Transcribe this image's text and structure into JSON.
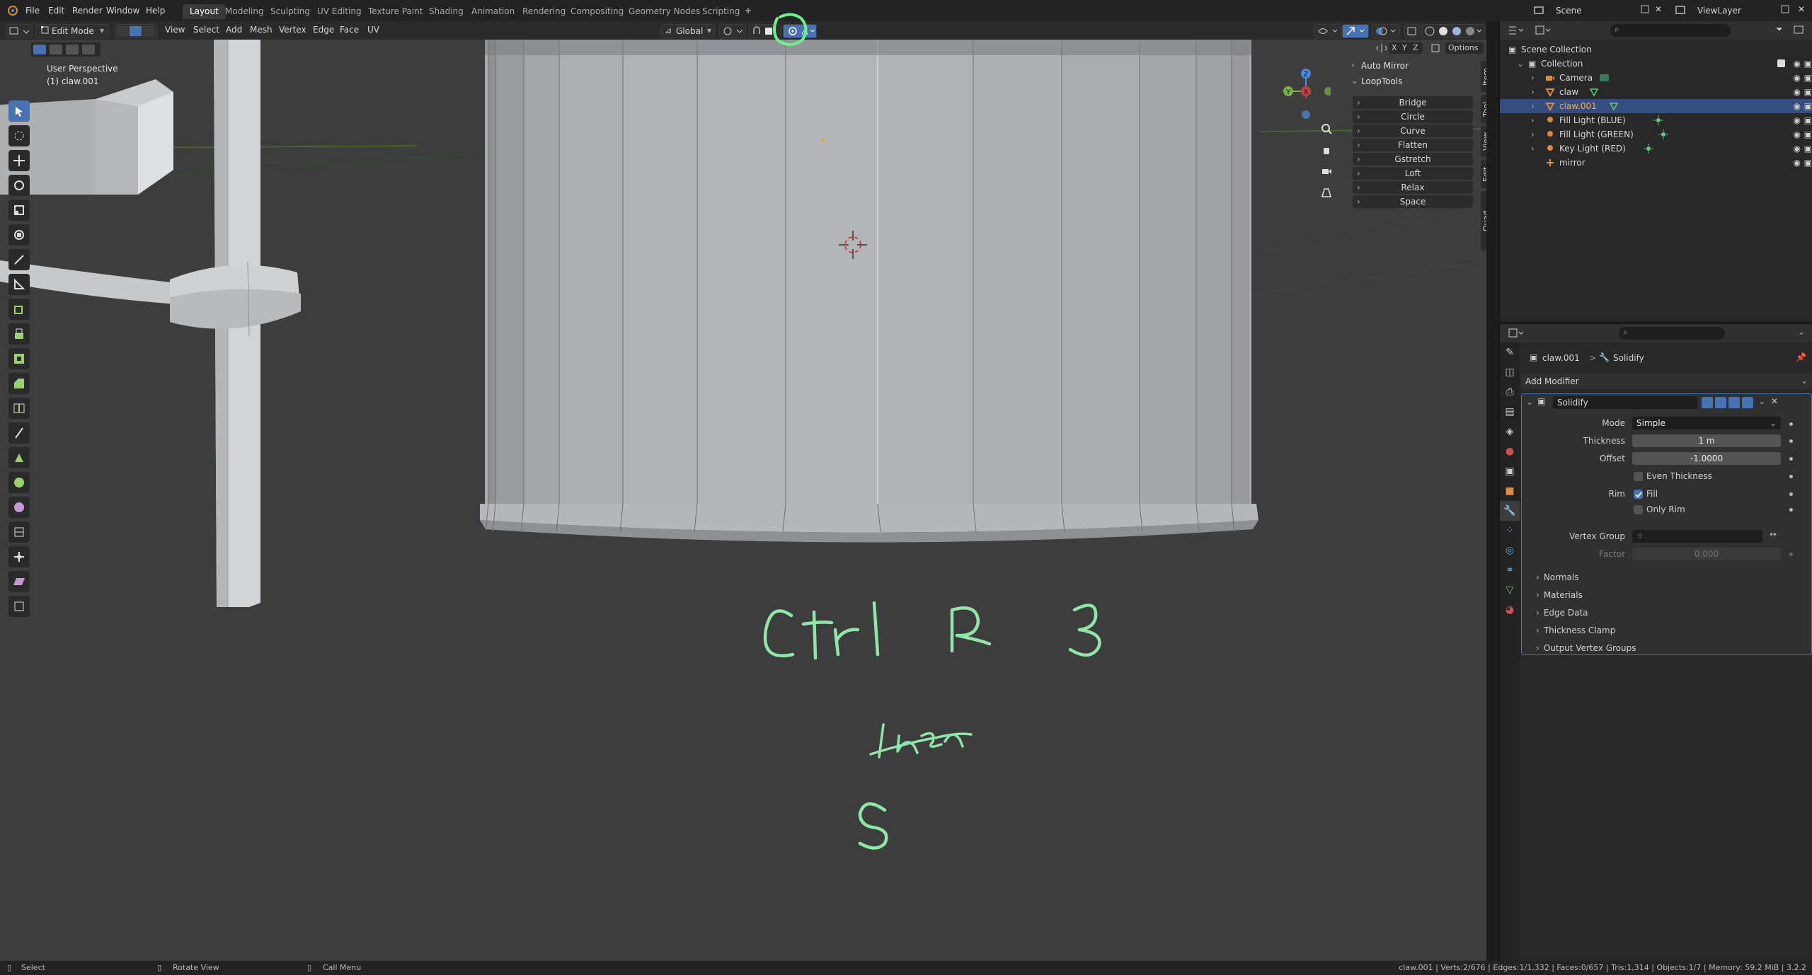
{
  "menu": {
    "items": [
      "File",
      "Edit",
      "Render",
      "Window",
      "Help"
    ],
    "workspaces": [
      "Layout",
      "Modeling",
      "Sculpting",
      "UV Editing",
      "Texture Paint",
      "Shading",
      "Animation",
      "Rendering",
      "Compositing",
      "Geometry Nodes",
      "Scripting"
    ],
    "active_workspace": "Layout",
    "add_workspace": "+",
    "scene_label": "Scene",
    "view_layer_label": "ViewLayer"
  },
  "viewport_header": {
    "mode": "Edit Mode",
    "menus": [
      "View",
      "Select",
      "Add",
      "Mesh",
      "Vertex",
      "Edge",
      "Face",
      "UV"
    ],
    "transform_orientation": "Global",
    "options_label": "Options",
    "axis_x": "X",
    "axis_y": "Y",
    "axis_z": "Z"
  },
  "viewport": {
    "perspective_label": "User Perspective",
    "object_label": "(1) claw.001",
    "annotation_lines": [
      "Ctrl R 3",
      "then",
      "S"
    ],
    "annotation_color": "#8ee6a8",
    "highlight_circle_color": "#6ef08a",
    "gizmo": {
      "x": "X",
      "y": "Y",
      "z": "Z"
    }
  },
  "npanel": {
    "auto_mirror": "Auto Mirror",
    "looptools": "LoopTools",
    "buttons": [
      "Bridge",
      "Circle",
      "Curve",
      "Flatten",
      "Gstretch",
      "Loft",
      "Relax",
      "Space"
    ],
    "tabs": [
      "Item",
      "Tool",
      "View",
      "Edit",
      "Quad Remesh"
    ]
  },
  "outliner": {
    "root": "Scene Collection",
    "collection": "Collection",
    "objects": [
      {
        "name": "Camera",
        "icon": "camera-icon",
        "selected": false
      },
      {
        "name": "claw",
        "icon": "mesh-icon",
        "selected": false
      },
      {
        "name": "claw.001",
        "icon": "mesh-icon",
        "selected": true
      },
      {
        "name": "Fill Light (BLUE)",
        "icon": "light-icon",
        "selected": false
      },
      {
        "name": "Fill Light (GREEN)",
        "icon": "light-icon",
        "selected": false
      },
      {
        "name": "Key Light (RED)",
        "icon": "light-icon",
        "selected": false
      },
      {
        "name": "mirror",
        "icon": "empty-icon",
        "selected": false
      }
    ]
  },
  "properties": {
    "breadcrumb_object": "claw.001",
    "breadcrumb_sep": ">",
    "breadcrumb_modifier": "Solidify",
    "add_modifier": "Add Modifier",
    "modifier_name": "Solidify",
    "mode_label": "Mode",
    "mode_value": "Simple",
    "thickness_label": "Thickness",
    "thickness_value": "1 m",
    "offset_label": "Offset",
    "offset_value": "-1.0000",
    "even_thickness": "Even Thickness",
    "rim_label": "Rim",
    "fill_label": "Fill",
    "only_rim": "Only Rim",
    "vertex_group_label": "Vertex Group",
    "factor_label": "Factor",
    "factor_value": "0.000",
    "subpanels": [
      "Normals",
      "Materials",
      "Edge Data",
      "Thickness Clamp",
      "Output Vertex Groups"
    ]
  },
  "statusbar": {
    "select": "Select",
    "rotate_view": "Rotate View",
    "call_menu": "Call Menu",
    "stats": "claw.001 | Verts:2/676 | Edges:1/1,332 | Faces:0/657 | Tris:1,314 | Objects:1/7 | Memory: 59.2 MiB | 3.2.2"
  }
}
